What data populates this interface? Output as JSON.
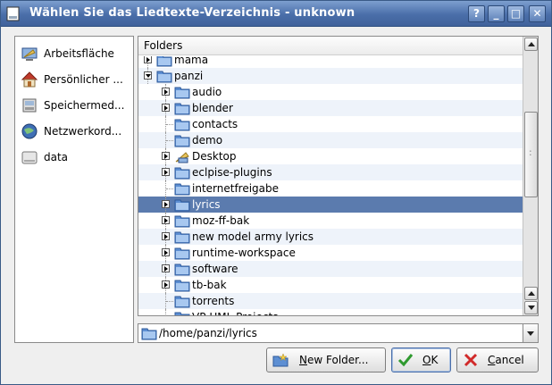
{
  "window": {
    "title": "Wählen Sie das Liedtexte-Verzeichnis - unknown",
    "controls": {
      "help": "?",
      "minimize": "_",
      "maximize": "□",
      "close": "✕"
    }
  },
  "places": [
    {
      "label": "Arbeitsfläche",
      "icon": "desktop-icon"
    },
    {
      "label": "Persönlicher ...",
      "icon": "home-icon"
    },
    {
      "label": "Speichermed...",
      "icon": "storage-media-icon"
    },
    {
      "label": "Netzwerkord...",
      "icon": "network-folders-icon"
    },
    {
      "label": "data",
      "icon": "drive-icon"
    }
  ],
  "tree": {
    "header": "Folders",
    "items": [
      {
        "label": "mama",
        "level": 1,
        "expander": "collapsed"
      },
      {
        "label": "panzi",
        "level": 1,
        "expander": "expanded"
      },
      {
        "label": "audio",
        "level": 2,
        "expander": "collapsed"
      },
      {
        "label": "blender",
        "level": 2,
        "expander": "collapsed"
      },
      {
        "label": "contacts",
        "level": 2,
        "expander": "none"
      },
      {
        "label": "demo",
        "level": 2,
        "expander": "none"
      },
      {
        "label": "Desktop",
        "level": 2,
        "expander": "collapsed",
        "icon": "desktop-folder-icon"
      },
      {
        "label": "eclpise-plugins",
        "level": 2,
        "expander": "collapsed"
      },
      {
        "label": "internetfreigabe",
        "level": 2,
        "expander": "none"
      },
      {
        "label": "lyrics",
        "level": 2,
        "expander": "collapsed",
        "selected": true
      },
      {
        "label": "moz-ff-bak",
        "level": 2,
        "expander": "collapsed"
      },
      {
        "label": "new model army lyrics",
        "level": 2,
        "expander": "collapsed"
      },
      {
        "label": "runtime-workspace",
        "level": 2,
        "expander": "collapsed"
      },
      {
        "label": "software",
        "level": 2,
        "expander": "collapsed"
      },
      {
        "label": "tb-bak",
        "level": 2,
        "expander": "collapsed"
      },
      {
        "label": "torrents",
        "level": 2,
        "expander": "none"
      },
      {
        "label": "VP-UML Projects",
        "level": 2,
        "expander": "none"
      }
    ]
  },
  "path": {
    "value": "/home/panzi/lyrics"
  },
  "buttons": {
    "new_folder": {
      "label_prefix": "",
      "mnemonic": "N",
      "label_rest": "ew Folder..."
    },
    "ok": {
      "mnemonic": "O",
      "label_rest": "K"
    },
    "cancel": {
      "mnemonic": "C",
      "label_rest": "ancel"
    }
  },
  "colors": {
    "titlebar": "#4a6ea9",
    "selection": "#5b7bae",
    "folder": "#5d8fd3"
  }
}
